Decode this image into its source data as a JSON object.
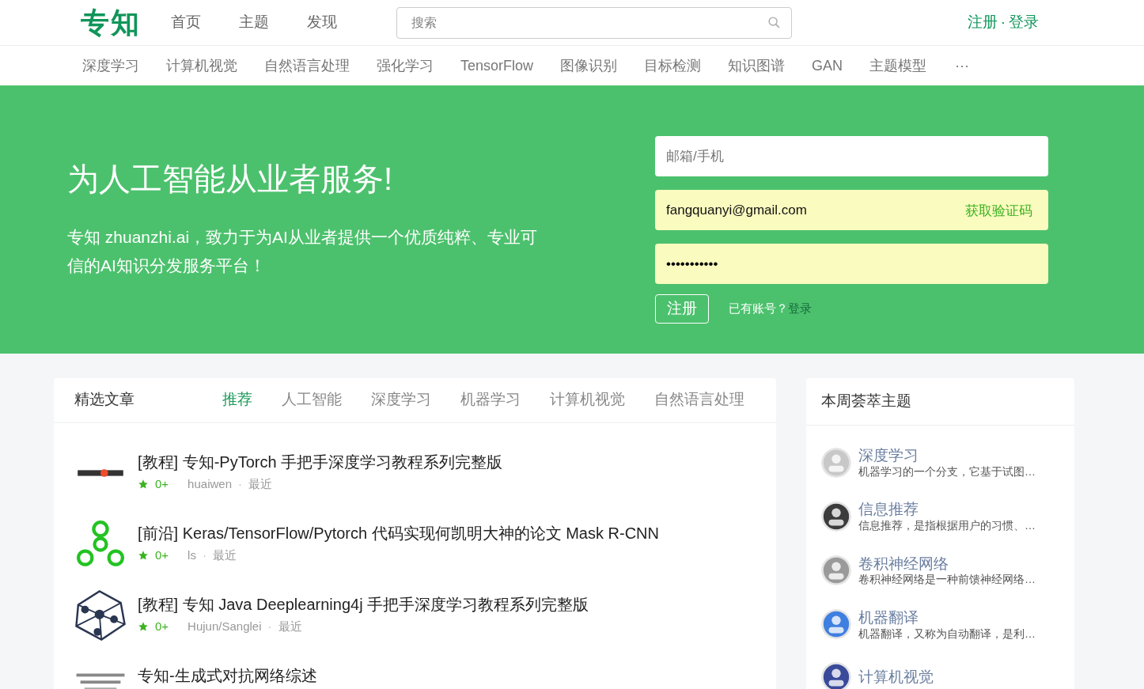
{
  "header": {
    "logo": "专知",
    "nav": [
      "首页",
      "主题",
      "发现"
    ],
    "search": {
      "placeholder": "搜索"
    },
    "register": "注册",
    "separator": "·",
    "login": "登录"
  },
  "categories": {
    "items": [
      "深度学习",
      "计算机视觉",
      "自然语言处理",
      "强化学习",
      "TensorFlow",
      "图像识别",
      "目标检测",
      "知识图谱",
      "GAN",
      "主题模型"
    ],
    "more": "···"
  },
  "hero": {
    "title": "为人工智能从业者服务!",
    "subtitle": "专知 zhuanzhi.ai，致力于为AI从业者提供一个优质纯粹、专业可信的AI知识分发服务平台！",
    "form": {
      "account": {
        "placeholder": "邮箱/手机"
      },
      "email": {
        "value": "fangquanyi@gmail.com"
      },
      "code_button": "获取验证码",
      "password": {
        "value": "•••••••••••"
      },
      "submit": "注册",
      "hint": "已有账号？",
      "login_link": "登录"
    }
  },
  "articles": {
    "title": "精选文章",
    "tabs": [
      {
        "label": "推荐",
        "selected": true
      },
      {
        "label": "人工智能",
        "selected": false
      },
      {
        "label": "深度学习",
        "selected": false
      },
      {
        "label": "机器学习",
        "selected": false
      },
      {
        "label": "计算机视觉",
        "selected": false
      },
      {
        "label": "自然语言处理",
        "selected": false
      }
    ],
    "items": [
      {
        "title": "[教程] 专知-PyTorch 手把手深度学习教程系列完整版",
        "score": "0+",
        "author": "huaiwen",
        "separator": "·",
        "time": "最近"
      },
      {
        "title": "[前沿] Keras/TensorFlow/Pytorch 代码实现何凯明大神的论文 Mask R-CNN",
        "score": "0+",
        "author": "ls",
        "separator": "·",
        "time": "最近"
      },
      {
        "title": "[教程] 专知 Java Deeplearning4j 手把手深度学习教程系列完整版",
        "score": "0+",
        "author": "Hujun/Sanglei",
        "separator": "·",
        "time": "最近"
      },
      {
        "title": "专知-生成式对抗网络综述"
      }
    ]
  },
  "topics": {
    "title": "本周荟萃主题",
    "items": [
      {
        "name": "深度学习",
        "description": "机器学习的一个分支，它基于试图…"
      },
      {
        "name": "信息推荐",
        "description": "信息推荐，是指根据用户的习惯、…"
      },
      {
        "name": "卷积神经网络",
        "description": "卷积神经网络是一种前馈神经网络…"
      },
      {
        "name": "机器翻译",
        "description": "机器翻译，又称为自动翻译，是利…"
      },
      {
        "name": "计算机视觉"
      }
    ]
  }
}
